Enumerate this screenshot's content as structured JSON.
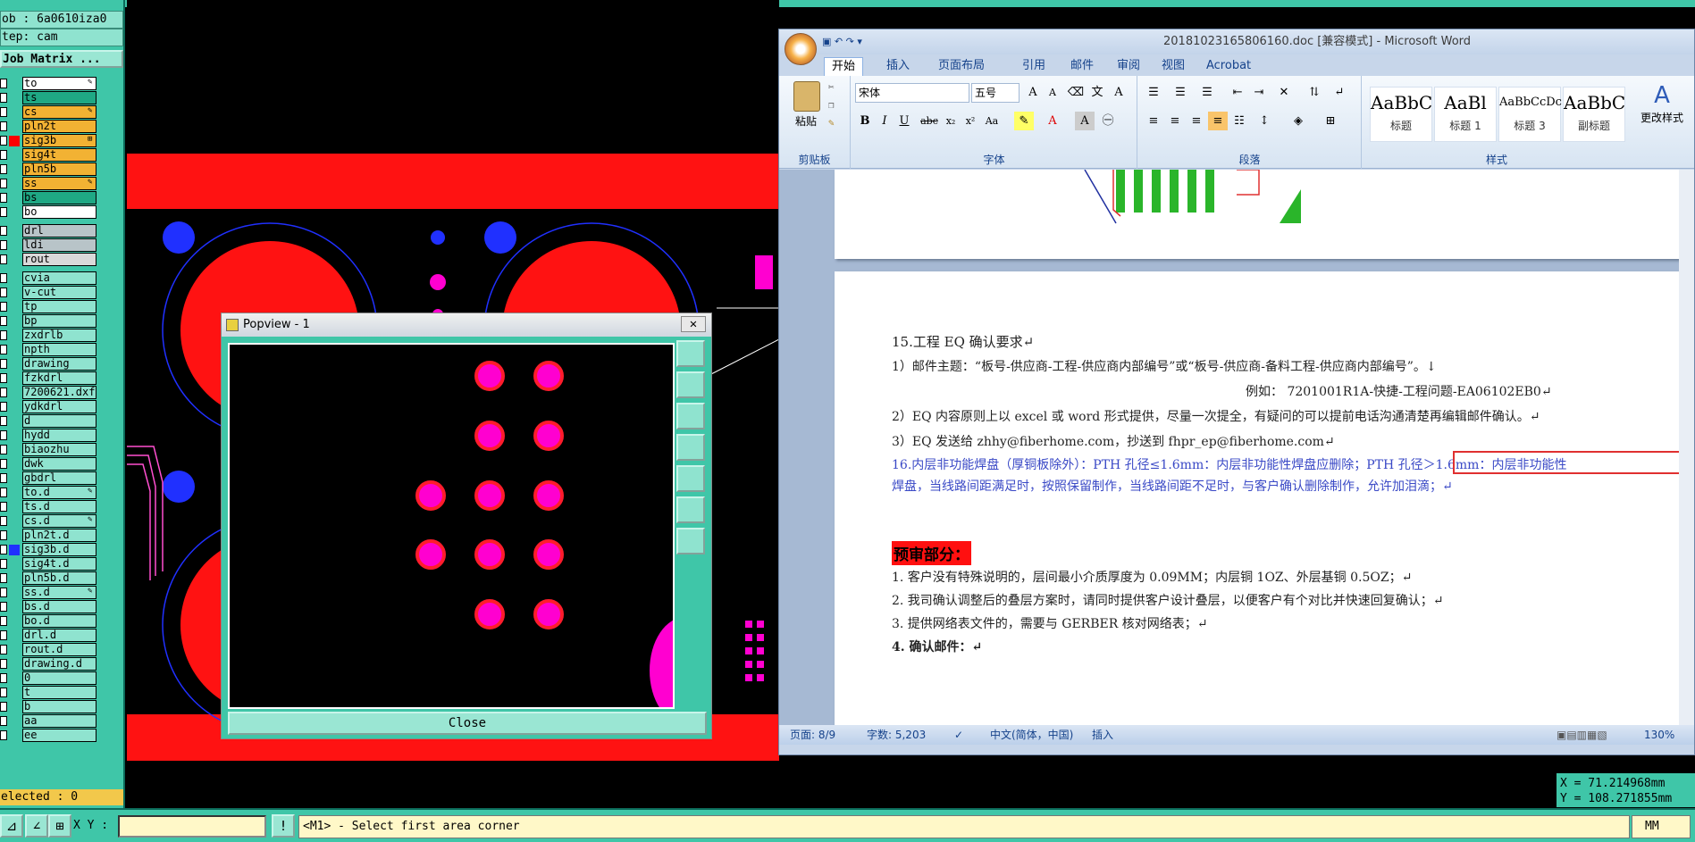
{
  "cam": {
    "job_label": "ob : 6a0610iza0",
    "step_label": "tep: cam",
    "matrix_button": "Job Matrix ...",
    "selected_label": "elected : 0",
    "layers": [
      {
        "name": "to",
        "color": "#ffffff",
        "flag": "✎"
      },
      {
        "name": "ts",
        "color": "#1fa884",
        "flag": ""
      },
      {
        "name": "cs",
        "color": "#f2b233",
        "flag": "✎"
      },
      {
        "name": "pln2t",
        "color": "#f2b233",
        "flag": ""
      },
      {
        "name": "sig3b",
        "color": "#f2b233",
        "flag": "⊞",
        "marker": "#ff0000"
      },
      {
        "name": "sig4t",
        "color": "#f2b233",
        "flag": ""
      },
      {
        "name": "pln5b",
        "color": "#f2b233",
        "flag": ""
      },
      {
        "name": "ss",
        "color": "#f2b233",
        "flag": "✎"
      },
      {
        "name": "bs",
        "color": "#1fa884",
        "flag": ""
      },
      {
        "name": "bo",
        "color": "#ffffff",
        "flag": ""
      },
      {
        "name": "drl",
        "color": "#b8c4c8",
        "flag": "",
        "gap": true
      },
      {
        "name": "ldi",
        "color": "#b8c4c8",
        "flag": ""
      },
      {
        "name": "rout",
        "color": "#d9d9d9",
        "flag": ""
      },
      {
        "name": "cvia",
        "color": "#8fe3cf",
        "flag": "",
        "gap": true
      },
      {
        "name": "v-cut",
        "color": "#8fe3cf",
        "flag": ""
      },
      {
        "name": "tp",
        "color": "#8fe3cf",
        "flag": ""
      },
      {
        "name": "bp",
        "color": "#8fe3cf",
        "flag": ""
      },
      {
        "name": "zxdrlb",
        "color": "#8fe3cf",
        "flag": ""
      },
      {
        "name": "npth",
        "color": "#8fe3cf",
        "flag": ""
      },
      {
        "name": "drawing",
        "color": "#8fe3cf",
        "flag": ""
      },
      {
        "name": "fzkdrl",
        "color": "#8fe3cf",
        "flag": ""
      },
      {
        "name": "7200621.dxf",
        "color": "#8fe3cf",
        "flag": ""
      },
      {
        "name": "ydkdrl",
        "color": "#8fe3cf",
        "flag": ""
      },
      {
        "name": "d",
        "color": "#8fe3cf",
        "flag": ""
      },
      {
        "name": "hydd",
        "color": "#8fe3cf",
        "flag": ""
      },
      {
        "name": "biaozhu",
        "color": "#8fe3cf",
        "flag": ""
      },
      {
        "name": "dwk",
        "color": "#8fe3cf",
        "flag": ""
      },
      {
        "name": "gbdrl",
        "color": "#8fe3cf",
        "flag": ""
      },
      {
        "name": "to.d",
        "color": "#8fe3cf",
        "flag": "✎"
      },
      {
        "name": "ts.d",
        "color": "#8fe3cf",
        "flag": ""
      },
      {
        "name": "cs.d",
        "color": "#8fe3cf",
        "flag": "✎"
      },
      {
        "name": "pln2t.d",
        "color": "#8fe3cf",
        "flag": ""
      },
      {
        "name": "sig3b.d",
        "color": "#8fe3cf",
        "flag": "",
        "marker": "#2030ff"
      },
      {
        "name": "sig4t.d",
        "color": "#8fe3cf",
        "flag": ""
      },
      {
        "name": "pln5b.d",
        "color": "#8fe3cf",
        "flag": ""
      },
      {
        "name": "ss.d",
        "color": "#8fe3cf",
        "flag": "✎"
      },
      {
        "name": "bs.d",
        "color": "#8fe3cf",
        "flag": ""
      },
      {
        "name": "bo.d",
        "color": "#8fe3cf",
        "flag": ""
      },
      {
        "name": "drl.d",
        "color": "#8fe3cf",
        "flag": ""
      },
      {
        "name": "rout.d",
        "color": "#8fe3cf",
        "flag": ""
      },
      {
        "name": "drawing.d",
        "color": "#8fe3cf",
        "flag": ""
      },
      {
        "name": "0",
        "color": "#8fe3cf",
        "flag": ""
      },
      {
        "name": "t",
        "color": "#8fe3cf",
        "flag": ""
      },
      {
        "name": "b",
        "color": "#8fe3cf",
        "flag": ""
      },
      {
        "name": "aa",
        "color": "#8fe3cf",
        "flag": ""
      },
      {
        "name": "ee",
        "color": "#8fe3cf",
        "flag": ""
      }
    ],
    "xy_label": "X Y :",
    "xy_value": "",
    "status_message": "<M1> - Select first area corner",
    "units": "MM",
    "x_coord": "X = 71.214968mm",
    "y_coord": "Y = 108.271855mm",
    "colors": {
      "board_red": "#ff1212",
      "pad_magenta": "#ff00d0",
      "trace_blue": "#2030ff"
    }
  },
  "popview": {
    "title": "Popview - 1",
    "close_label": "Close",
    "close_x": "✕"
  },
  "word": {
    "title": "20181023165806160.doc [兼容模式] - Microsoft Word",
    "tabs": [
      "开始",
      "插入",
      "页面布局",
      "引用",
      "邮件",
      "审阅",
      "视图",
      "Acrobat"
    ],
    "clipboard": {
      "paste": "粘贴",
      "group": "剪贴板"
    },
    "font": {
      "name": "宋体",
      "size": "五号",
      "group": "字体"
    },
    "paragraph_group": "段落",
    "styles": [
      {
        "sample": "AaBbC",
        "name": "标题"
      },
      {
        "sample": "AaBl",
        "name": "标题 1"
      },
      {
        "sample": "AaBbCcDc",
        "name": "标题 3"
      },
      {
        "sample": "AaBbC",
        "name": "副标题"
      }
    ],
    "change_styles": "更改样式",
    "styles_group": "样式",
    "doc": {
      "s15": "15.工程 EQ 确认要求↵",
      "l1": "1）邮件主题：“板号-供应商-工程-供应商内部编号”或“板号-供应商-备料工程-供应商内部编号”。↓",
      "example": "例如：      7201001R1A-快捷-工程问题-EA06102EB0↵",
      "l2": "2）EQ 内容原则上以 excel 或 word 形式提供，尽量一次提全，有疑问的可以提前电话沟通清楚再编辑邮件确认。↵",
      "l3": "3）EQ 发送给 zhhy@fiberhome.com，抄送到 fhpr_ep@fiberhome.com↵",
      "s16a": "16.内层非功能焊盘（厚铜板除外）：PTH 孔径≤1.6mm：内层非功能性焊盘应删除；PTH 孔径＞1.6mm：内层非功能性",
      "s16b": "焊盘，当线路间距满足时，按照保留制作，当线路间距不足时，与客户确认删除制作，允许加泪滴；↵",
      "pre_title": "预审部分：",
      "i1": "1.    客户没有特殊说明的，层间最小介质厚度为 0.09MM；内层铜 1OZ、外层基铜 0.5OZ；↵",
      "i2": "2.    我司确认调整后的叠层方案时，请同时提供客户设计叠层，以便客户有个对比并快速回复确认；↵",
      "i3": "3.    提供网络表文件的，需要与 GERBER 核对网络表；↵",
      "i4": "4.    确认邮件：↵"
    },
    "status": {
      "page": "页面: 8/9",
      "words": "字数: 5,203",
      "lang": "中文(简体，中国)",
      "mode": "插入",
      "zoom": "130%"
    }
  }
}
